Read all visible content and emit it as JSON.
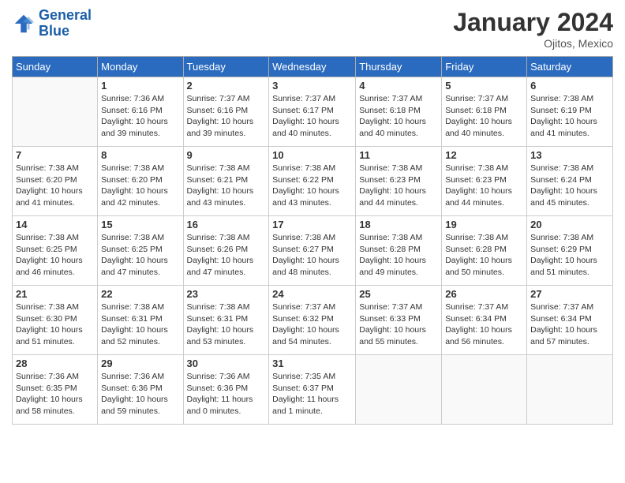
{
  "header": {
    "logo_line1": "General",
    "logo_line2": "Blue",
    "month_year": "January 2024",
    "location": "Ojitos, Mexico"
  },
  "days_of_week": [
    "Sunday",
    "Monday",
    "Tuesday",
    "Wednesday",
    "Thursday",
    "Friday",
    "Saturday"
  ],
  "weeks": [
    [
      {
        "day": "",
        "info": ""
      },
      {
        "day": "1",
        "info": "Sunrise: 7:36 AM\nSunset: 6:16 PM\nDaylight: 10 hours\nand 39 minutes."
      },
      {
        "day": "2",
        "info": "Sunrise: 7:37 AM\nSunset: 6:16 PM\nDaylight: 10 hours\nand 39 minutes."
      },
      {
        "day": "3",
        "info": "Sunrise: 7:37 AM\nSunset: 6:17 PM\nDaylight: 10 hours\nand 40 minutes."
      },
      {
        "day": "4",
        "info": "Sunrise: 7:37 AM\nSunset: 6:18 PM\nDaylight: 10 hours\nand 40 minutes."
      },
      {
        "day": "5",
        "info": "Sunrise: 7:37 AM\nSunset: 6:18 PM\nDaylight: 10 hours\nand 40 minutes."
      },
      {
        "day": "6",
        "info": "Sunrise: 7:38 AM\nSunset: 6:19 PM\nDaylight: 10 hours\nand 41 minutes."
      }
    ],
    [
      {
        "day": "7",
        "info": "Sunrise: 7:38 AM\nSunset: 6:20 PM\nDaylight: 10 hours\nand 41 minutes."
      },
      {
        "day": "8",
        "info": "Sunrise: 7:38 AM\nSunset: 6:20 PM\nDaylight: 10 hours\nand 42 minutes."
      },
      {
        "day": "9",
        "info": "Sunrise: 7:38 AM\nSunset: 6:21 PM\nDaylight: 10 hours\nand 43 minutes."
      },
      {
        "day": "10",
        "info": "Sunrise: 7:38 AM\nSunset: 6:22 PM\nDaylight: 10 hours\nand 43 minutes."
      },
      {
        "day": "11",
        "info": "Sunrise: 7:38 AM\nSunset: 6:23 PM\nDaylight: 10 hours\nand 44 minutes."
      },
      {
        "day": "12",
        "info": "Sunrise: 7:38 AM\nSunset: 6:23 PM\nDaylight: 10 hours\nand 44 minutes."
      },
      {
        "day": "13",
        "info": "Sunrise: 7:38 AM\nSunset: 6:24 PM\nDaylight: 10 hours\nand 45 minutes."
      }
    ],
    [
      {
        "day": "14",
        "info": "Sunrise: 7:38 AM\nSunset: 6:25 PM\nDaylight: 10 hours\nand 46 minutes."
      },
      {
        "day": "15",
        "info": "Sunrise: 7:38 AM\nSunset: 6:25 PM\nDaylight: 10 hours\nand 47 minutes."
      },
      {
        "day": "16",
        "info": "Sunrise: 7:38 AM\nSunset: 6:26 PM\nDaylight: 10 hours\nand 47 minutes."
      },
      {
        "day": "17",
        "info": "Sunrise: 7:38 AM\nSunset: 6:27 PM\nDaylight: 10 hours\nand 48 minutes."
      },
      {
        "day": "18",
        "info": "Sunrise: 7:38 AM\nSunset: 6:28 PM\nDaylight: 10 hours\nand 49 minutes."
      },
      {
        "day": "19",
        "info": "Sunrise: 7:38 AM\nSunset: 6:28 PM\nDaylight: 10 hours\nand 50 minutes."
      },
      {
        "day": "20",
        "info": "Sunrise: 7:38 AM\nSunset: 6:29 PM\nDaylight: 10 hours\nand 51 minutes."
      }
    ],
    [
      {
        "day": "21",
        "info": "Sunrise: 7:38 AM\nSunset: 6:30 PM\nDaylight: 10 hours\nand 51 minutes."
      },
      {
        "day": "22",
        "info": "Sunrise: 7:38 AM\nSunset: 6:31 PM\nDaylight: 10 hours\nand 52 minutes."
      },
      {
        "day": "23",
        "info": "Sunrise: 7:38 AM\nSunset: 6:31 PM\nDaylight: 10 hours\nand 53 minutes."
      },
      {
        "day": "24",
        "info": "Sunrise: 7:37 AM\nSunset: 6:32 PM\nDaylight: 10 hours\nand 54 minutes."
      },
      {
        "day": "25",
        "info": "Sunrise: 7:37 AM\nSunset: 6:33 PM\nDaylight: 10 hours\nand 55 minutes."
      },
      {
        "day": "26",
        "info": "Sunrise: 7:37 AM\nSunset: 6:34 PM\nDaylight: 10 hours\nand 56 minutes."
      },
      {
        "day": "27",
        "info": "Sunrise: 7:37 AM\nSunset: 6:34 PM\nDaylight: 10 hours\nand 57 minutes."
      }
    ],
    [
      {
        "day": "28",
        "info": "Sunrise: 7:36 AM\nSunset: 6:35 PM\nDaylight: 10 hours\nand 58 minutes."
      },
      {
        "day": "29",
        "info": "Sunrise: 7:36 AM\nSunset: 6:36 PM\nDaylight: 10 hours\nand 59 minutes."
      },
      {
        "day": "30",
        "info": "Sunrise: 7:36 AM\nSunset: 6:36 PM\nDaylight: 11 hours\nand 0 minutes."
      },
      {
        "day": "31",
        "info": "Sunrise: 7:35 AM\nSunset: 6:37 PM\nDaylight: 11 hours\nand 1 minute."
      },
      {
        "day": "",
        "info": ""
      },
      {
        "day": "",
        "info": ""
      },
      {
        "day": "",
        "info": ""
      }
    ]
  ]
}
